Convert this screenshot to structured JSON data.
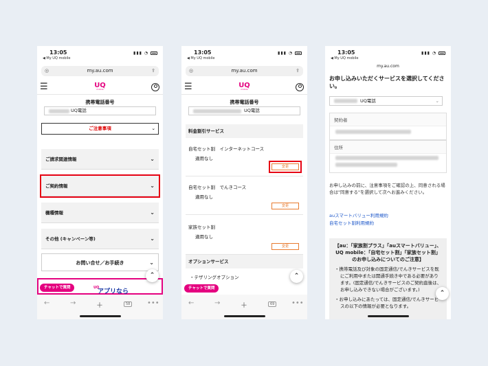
{
  "common": {
    "time": "13:05",
    "back_app": "◀ My UQ mobile",
    "url": "my.au.com",
    "tel_label": "携帯電話番号",
    "carrier": "UQ電話",
    "logo_main": "UQ",
    "logo_sub": "mobile",
    "chat_label": "チャットで質問"
  },
  "screen1": {
    "notice_label": "ご注意事項",
    "accordions": [
      {
        "label": "ご請求関連情報"
      },
      {
        "label": "ご契約情報"
      },
      {
        "label": "機種情報"
      },
      {
        "label": "その他 (キャンペーン等)"
      }
    ],
    "inquiry_label": "お問い合せ／お手続き",
    "promo_text": "アプリなら",
    "promo_logo": "UQ"
  },
  "screen2": {
    "section1": "料金割引サービス",
    "services": [
      {
        "name": "自宅セット割　インターネットコース",
        "status": "適用なし",
        "button": "変更"
      },
      {
        "name": "自宅セット割　でんきコース",
        "status": "適用なし",
        "button": "変更"
      },
      {
        "name": "家族セット割",
        "status": "適用なし",
        "button": "変更"
      }
    ],
    "section2": "オプションサービス",
    "option1": "・テザリングオプション"
  },
  "screen3": {
    "title": "お申し込みいただくサービスを選択してください。",
    "select_value": "UQ電話",
    "contractor_label": "契約者",
    "address_label": "住所",
    "body": "お申し込みの前に、注意事項をご確認の上、同意される場合は\"同意する\"を選択して次へお進みください。",
    "links": [
      "auスマートバリュー利用規約",
      "自宅セット割利用規約"
    ],
    "box_title": "【au：「家族割プラス」「auスマートバリュー」、UQ mobile：「自宅セット割」「家族セット割」のお申し込みについてのご注意】",
    "box_items": [
      "携帯電話及び対象の固定通信/でんきサービスを既にご利用中または開通手続き中である必要があります。(固定通信/でんきサービスのご契約直後は、お申し込みできない場合がございます。)",
      "お申し込みにあたっては、固定通信/でんきサービスの以下の情報が必要となります。"
    ]
  }
}
